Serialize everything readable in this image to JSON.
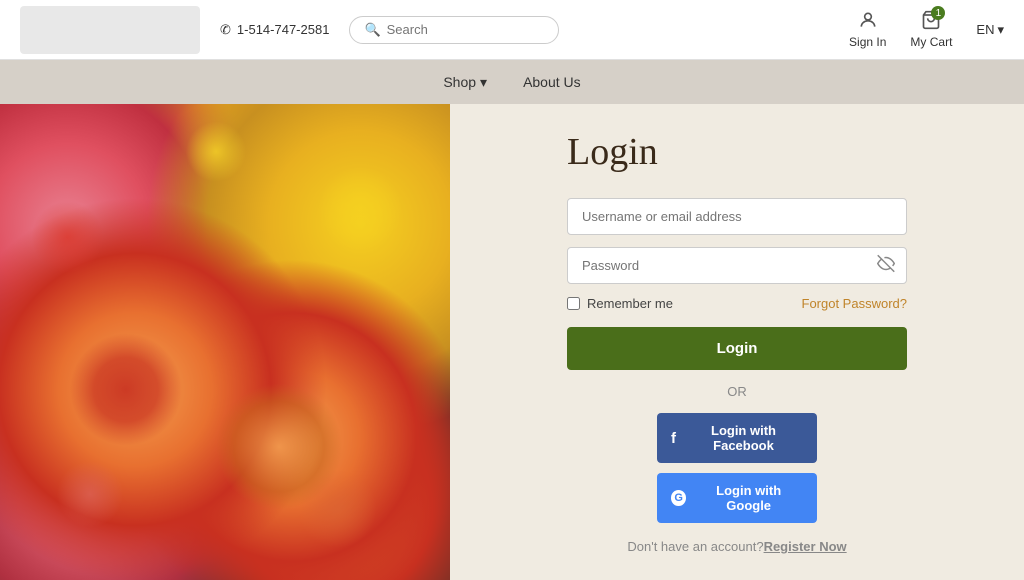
{
  "header": {
    "phone": "1-514-747-2581",
    "search_placeholder": "Search",
    "sign_in_label": "Sign In",
    "cart_label": "My Cart",
    "cart_count": "1",
    "lang": "EN"
  },
  "nav": {
    "shop_label": "Shop",
    "about_label": "About Us"
  },
  "login": {
    "title": "Login",
    "username_placeholder": "Username or email address",
    "password_placeholder": "Password",
    "remember_label": "Remember me",
    "forgot_label": "Forgot Password?",
    "login_btn": "Login",
    "or_text": "OR",
    "fb_btn": "Login with Facebook",
    "google_btn": "Login with Google",
    "no_account_text": "Don't have an account?",
    "register_label": "Register Now"
  }
}
